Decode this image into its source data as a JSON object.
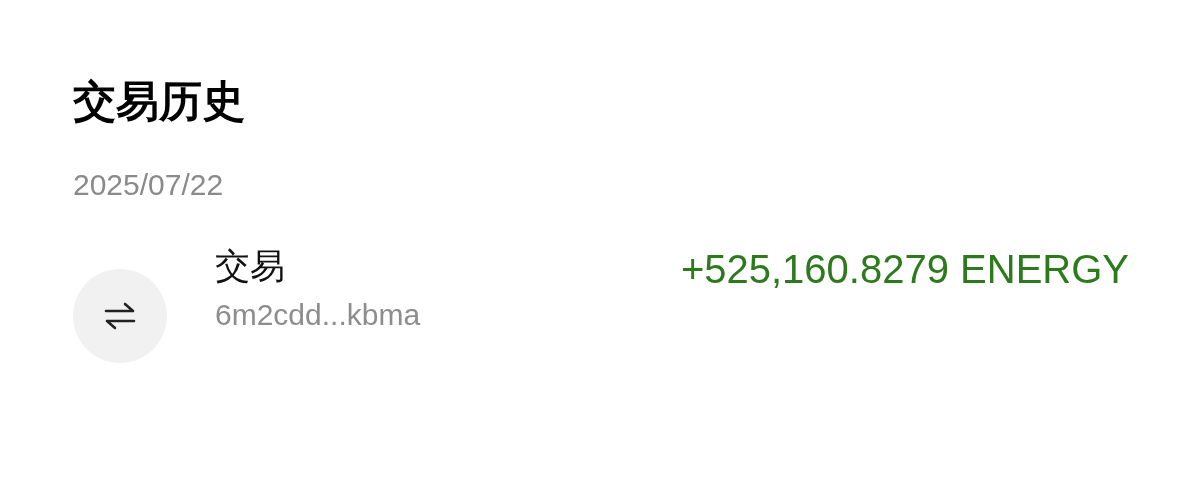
{
  "title": "交易历史",
  "groups": [
    {
      "date": "2025/07/22",
      "transactions": [
        {
          "label": "交易",
          "address": "6m2cdd...kbma",
          "amount": "+525,160.8279 ENERGY"
        }
      ]
    }
  ]
}
